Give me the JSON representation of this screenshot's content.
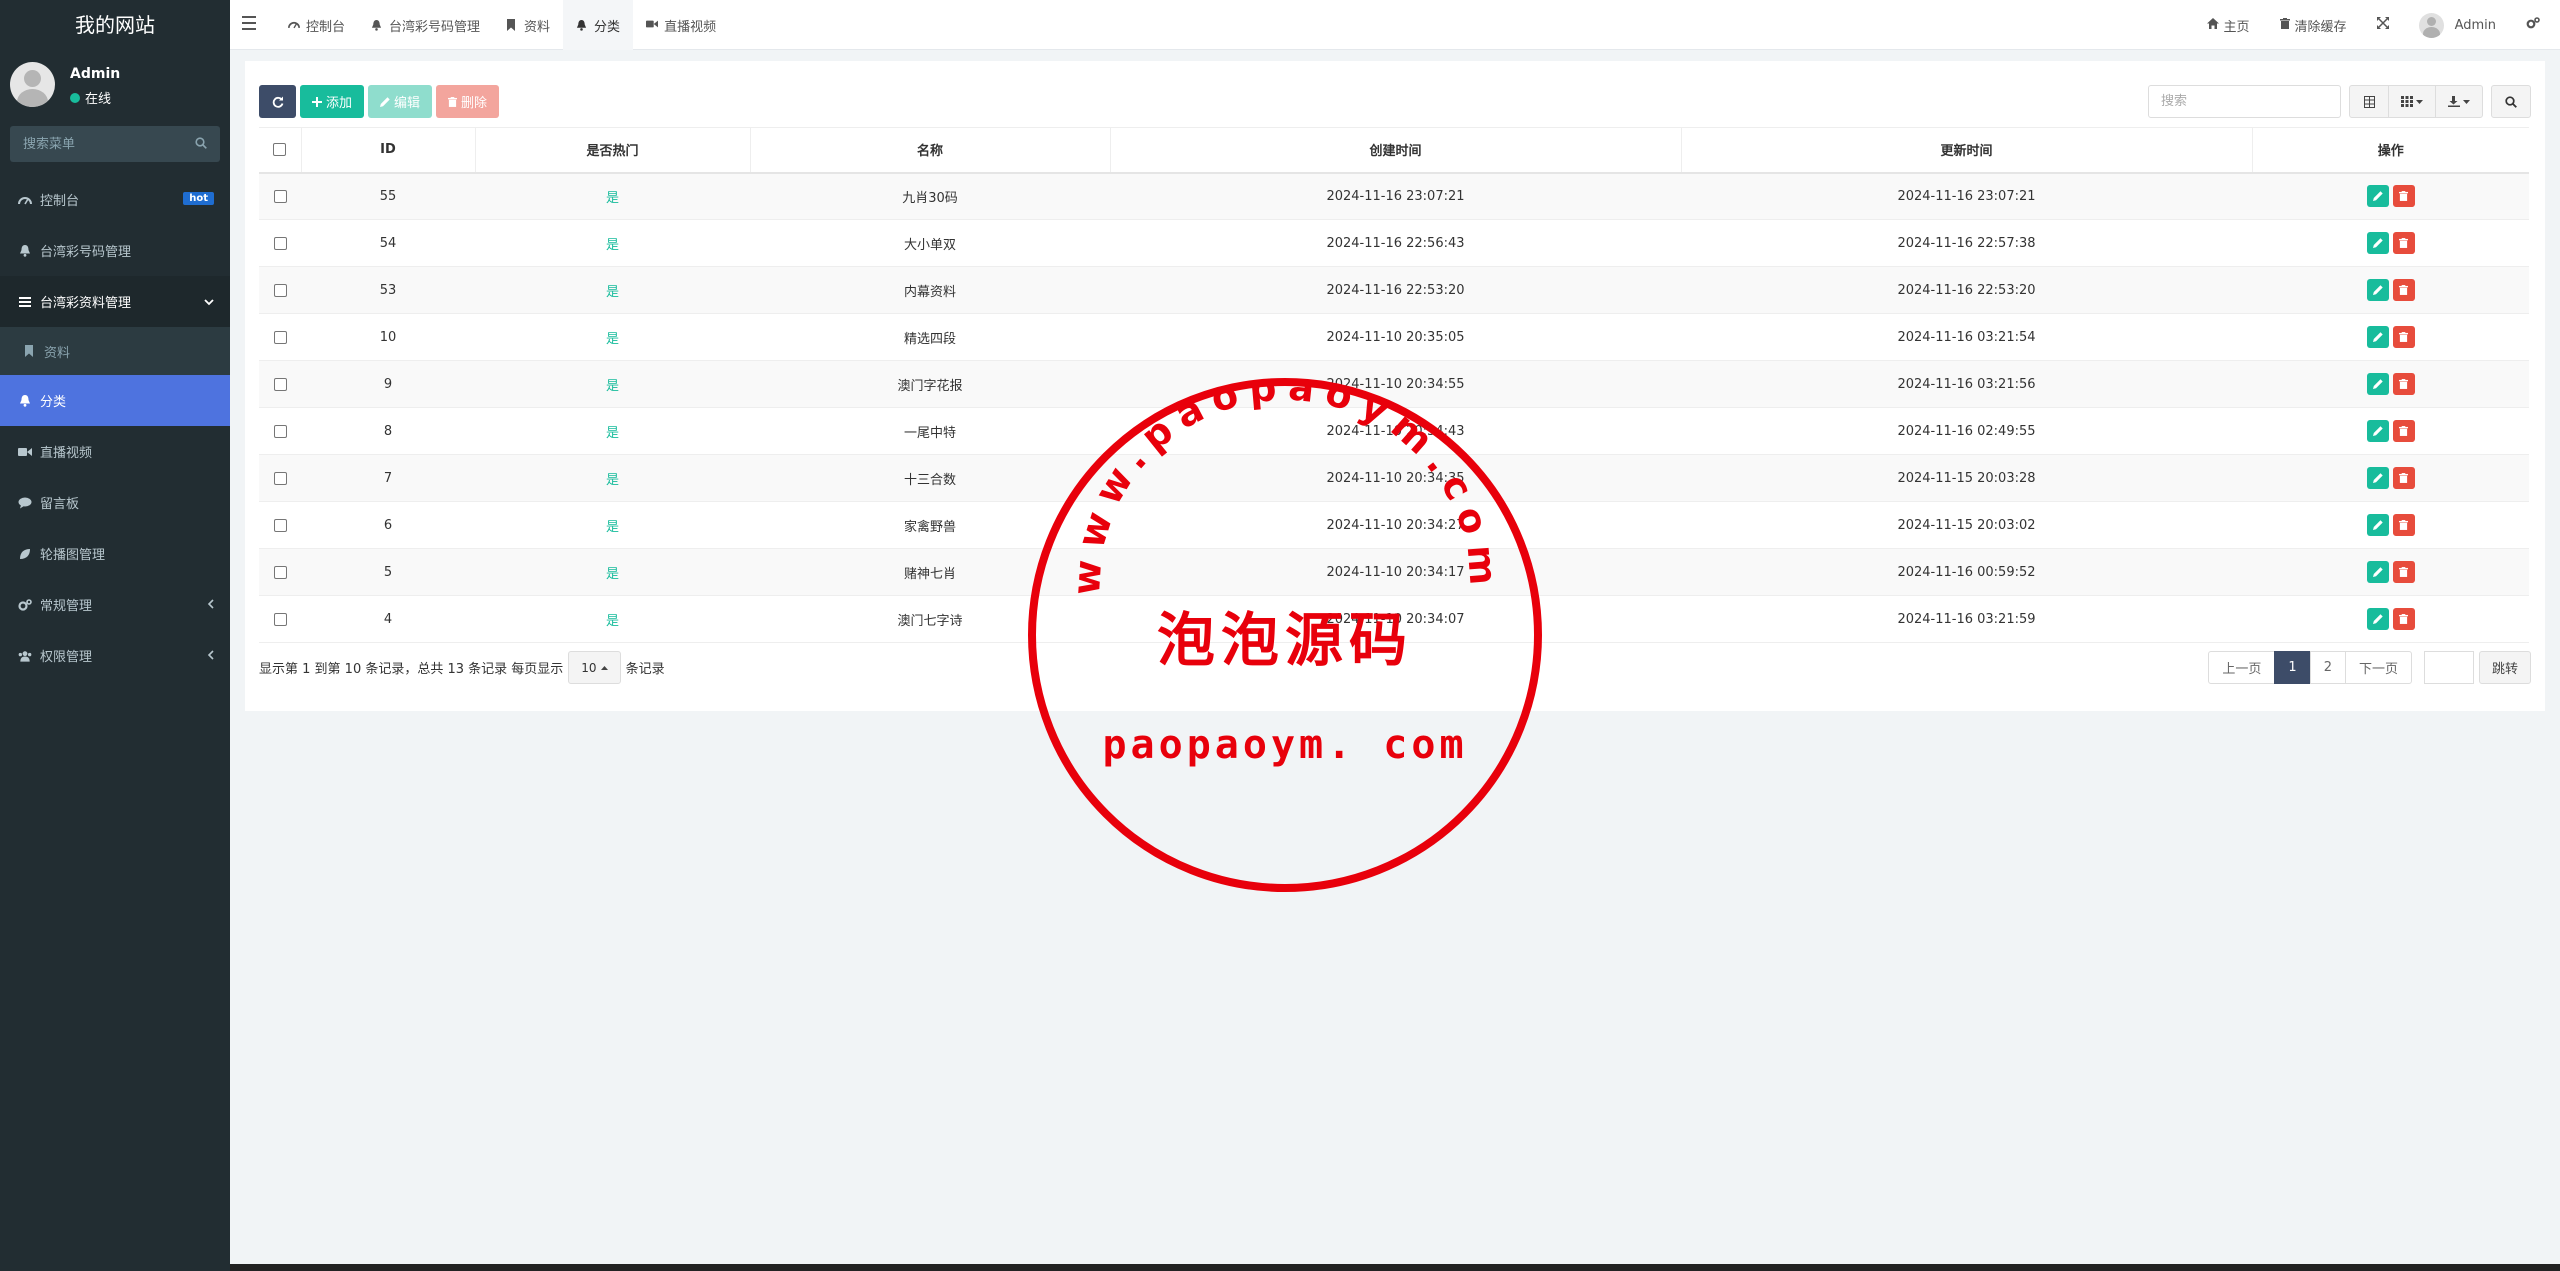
{
  "sidebar": {
    "logo": "我的网站",
    "user": {
      "name": "Admin",
      "status": "在线"
    },
    "search_placeholder": "搜索菜单",
    "items": [
      {
        "label": "控制台",
        "badge": "hot"
      },
      {
        "label": "台湾彩号码管理"
      },
      {
        "label": "台湾彩资料管理"
      },
      {
        "label": "资料"
      },
      {
        "label": "分类"
      },
      {
        "label": "直播视频"
      },
      {
        "label": "留言板"
      },
      {
        "label": "轮播图管理"
      },
      {
        "label": "常规管理"
      },
      {
        "label": "权限管理"
      }
    ]
  },
  "header": {
    "tabs": [
      {
        "label": "控制台"
      },
      {
        "label": "台湾彩号码管理"
      },
      {
        "label": "资料"
      },
      {
        "label": "分类"
      },
      {
        "label": "直播视频"
      }
    ],
    "home": "主页",
    "clear_cache": "清除缓存",
    "admin": "Admin"
  },
  "toolbar": {
    "add": "添加",
    "edit": "编辑",
    "delete": "删除",
    "search_placeholder": "搜索"
  },
  "table": {
    "columns": [
      "ID",
      "是否热门",
      "名称",
      "创建时间",
      "更新时间",
      "操作"
    ],
    "rows": [
      {
        "id": "55",
        "hot": "是",
        "name": "九肖30码",
        "created": "2024-11-16 23:07:21",
        "updated": "2024-11-16 23:07:21"
      },
      {
        "id": "54",
        "hot": "是",
        "name": "大小单双",
        "created": "2024-11-16 22:56:43",
        "updated": "2024-11-16 22:57:38"
      },
      {
        "id": "53",
        "hot": "是",
        "name": "内幕资料",
        "created": "2024-11-16 22:53:20",
        "updated": "2024-11-16 22:53:20"
      },
      {
        "id": "10",
        "hot": "是",
        "name": "精选四段",
        "created": "2024-11-10 20:35:05",
        "updated": "2024-11-16 03:21:54"
      },
      {
        "id": "9",
        "hot": "是",
        "name": "澳门字花报",
        "created": "2024-11-10 20:34:55",
        "updated": "2024-11-16 03:21:56"
      },
      {
        "id": "8",
        "hot": "是",
        "name": "一尾中特",
        "created": "2024-11-10 20:34:43",
        "updated": "2024-11-16 02:49:55"
      },
      {
        "id": "7",
        "hot": "是",
        "name": "十三合数",
        "created": "2024-11-10 20:34:35",
        "updated": "2024-11-15 20:03:28"
      },
      {
        "id": "6",
        "hot": "是",
        "name": "家禽野兽",
        "created": "2024-11-10 20:34:27",
        "updated": "2024-11-15 20:03:02"
      },
      {
        "id": "5",
        "hot": "是",
        "name": "赌神七肖",
        "created": "2024-11-10 20:34:17",
        "updated": "2024-11-16 00:59:52"
      },
      {
        "id": "4",
        "hot": "是",
        "name": "澳门七字诗",
        "created": "2024-11-10 20:34:07",
        "updated": "2024-11-16 03:21:59"
      }
    ]
  },
  "footer": {
    "info": "显示第 1 到第 10 条记录，总共 13 条记录 每页显示",
    "page_size": "10",
    "suffix": "条记录",
    "prev": "上一页",
    "pages": [
      "1",
      "2"
    ],
    "next": "下一页",
    "jump": "跳转"
  },
  "watermark": {
    "arc_text": "www.paopaoym.com",
    "cn_text": "泡泡源码",
    "bottom_text": "paopaoym. com"
  },
  "colors": {
    "sidebar_bg": "#222d32",
    "active_menu": "#4e73df",
    "primary": "#18bc9c",
    "danger": "#e74c3c",
    "stamp": "#e8000b"
  }
}
